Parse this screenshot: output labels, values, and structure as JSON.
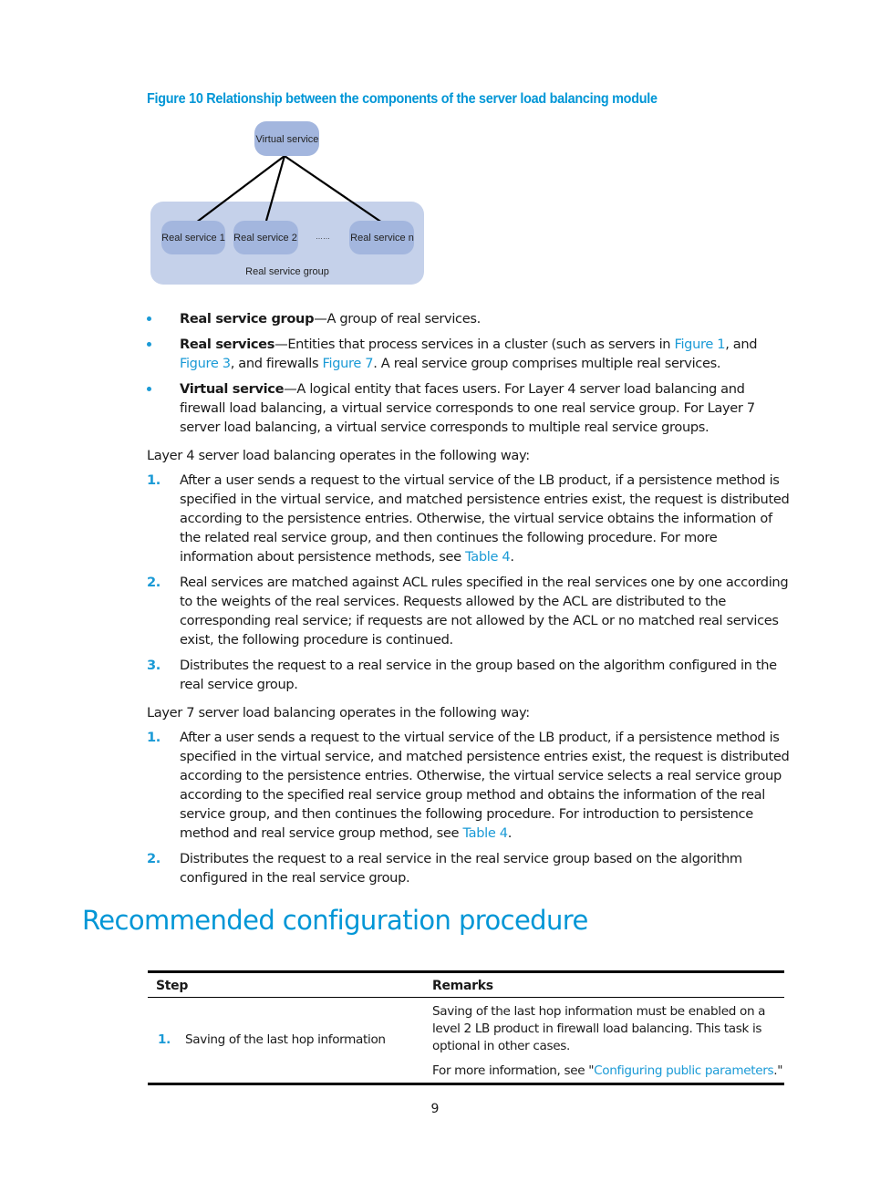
{
  "figure": {
    "caption": "Figure 10 Relationship between the components of the server load balancing module",
    "virtual_service_label": "Virtual service",
    "real_services": [
      "Real service 1",
      "Real service 2",
      "Real service n"
    ],
    "ellipsis": "……",
    "group_label": "Real service group",
    "colors": {
      "node": "#a3b6de",
      "group": "#c5d1ea",
      "line": "#000000"
    }
  },
  "bullets": [
    {
      "term": "Real service group",
      "dash": "—",
      "segments": [
        {
          "text": "A group of real services."
        }
      ]
    },
    {
      "term": "Real services",
      "dash": "—",
      "segments": [
        {
          "text": "Entities that process services in a cluster (such as servers in "
        },
        {
          "text": "Figure 1",
          "link": true
        },
        {
          "text": ", and "
        },
        {
          "text": "Figure 3",
          "link": true
        },
        {
          "text": ", and firewalls "
        },
        {
          "text": "Figure 7",
          "link": true
        },
        {
          "text": ". A real service group comprises multiple real services."
        }
      ]
    },
    {
      "term": "Virtual service",
      "dash": "—",
      "segments": [
        {
          "text": "A logical entity that faces users. For Layer 4 server load balancing and firewall load balancing, a virtual service corresponds to one real service group. For Layer 7 server load balancing, a virtual service corresponds to multiple real service groups."
        }
      ]
    }
  ],
  "layer4": {
    "intro": "Layer 4 server load balancing operates in the following way:",
    "steps": [
      {
        "num": "1.",
        "segments": [
          {
            "text": "After a user sends a request to the virtual service of the LB product, if a persistence method is specified in the virtual service, and matched persistence entries exist, the request is distributed according to the persistence entries. Otherwise, the virtual service obtains the information of the related real service group, and then continues the following procedure. For more information about persistence methods, see "
          },
          {
            "text": "Table 4",
            "link": true
          },
          {
            "text": "."
          }
        ]
      },
      {
        "num": "2.",
        "segments": [
          {
            "text": "Real services are matched against ACL rules specified in the real services one by one according to the weights of the real services. Requests allowed by the ACL are distributed to the corresponding real service; if requests are not allowed by the ACL or no matched real services exist, the following procedure is continued."
          }
        ]
      },
      {
        "num": "3.",
        "segments": [
          {
            "text": "Distributes the request to a real service in the group based on the algorithm configured in the real service group."
          }
        ]
      }
    ]
  },
  "layer7": {
    "intro": "Layer 7 server load balancing operates in the following way:",
    "steps": [
      {
        "num": "1.",
        "segments": [
          {
            "text": "After a user sends a request to the virtual service of the LB product, if a persistence method is specified in the virtual service, and matched persistence entries exist, the request is distributed according to the persistence entries. Otherwise, the virtual service selects a real service group according to the specified real service group method and obtains the information of the real service group, and then continues the following procedure. For introduction to persistence method and real service group method, see "
          },
          {
            "text": "Table 4",
            "link": true
          },
          {
            "text": "."
          }
        ]
      },
      {
        "num": "2.",
        "segments": [
          {
            "text": "Distributes the request to a real service in the real service group based on the algorithm configured in the real service group."
          }
        ]
      }
    ]
  },
  "section": {
    "heading": "Recommended configuration procedure"
  },
  "table": {
    "headers": {
      "step": "Step",
      "remarks": "Remarks"
    },
    "rows": [
      {
        "num": "1.",
        "step": "Saving of the last hop information",
        "remarks_p1": "Saving of the last hop information must be enabled on a level 2 LB product in firewall load balancing. This task is optional in other cases.",
        "remarks_p2_prefix": "For more information, see \"",
        "remarks_p2_link": "Configuring public parameters",
        "remarks_p2_suffix": ".\""
      }
    ]
  },
  "page_number": "9"
}
